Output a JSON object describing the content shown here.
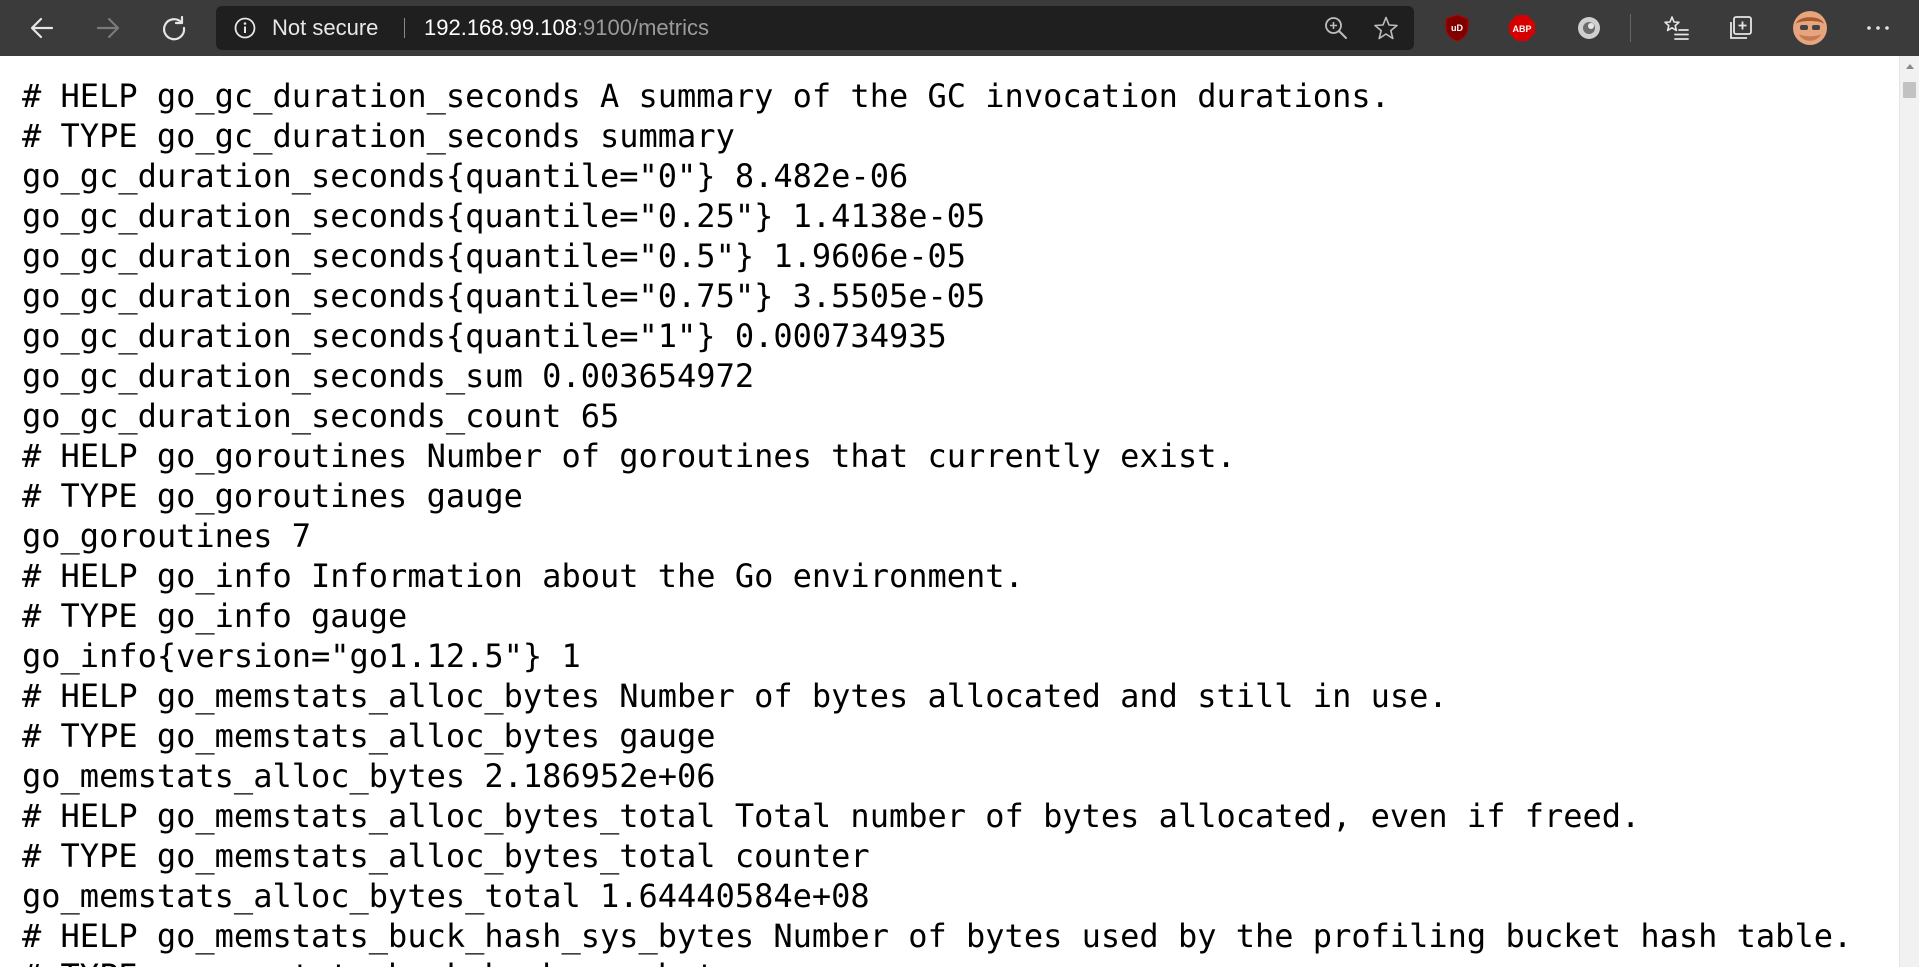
{
  "browser": {
    "security_label": "Not secure",
    "url_host": "192.168.99.108",
    "url_rest": ":9100/metrics",
    "extensions": [
      "ublock-origin-icon",
      "adblock-plus-icon",
      "circle-extension-icon"
    ],
    "abp_badge": "ABP",
    "ublock_badge": "uD",
    "accent_color": "#3b3b3b"
  },
  "metrics_lines": [
    "# HELP go_gc_duration_seconds A summary of the GC invocation durations.",
    "# TYPE go_gc_duration_seconds summary",
    "go_gc_duration_seconds{quantile=\"0\"} 8.482e-06",
    "go_gc_duration_seconds{quantile=\"0.25\"} 1.4138e-05",
    "go_gc_duration_seconds{quantile=\"0.5\"} 1.9606e-05",
    "go_gc_duration_seconds{quantile=\"0.75\"} 3.5505e-05",
    "go_gc_duration_seconds{quantile=\"1\"} 0.000734935",
    "go_gc_duration_seconds_sum 0.003654972",
    "go_gc_duration_seconds_count 65",
    "# HELP go_goroutines Number of goroutines that currently exist.",
    "# TYPE go_goroutines gauge",
    "go_goroutines 7",
    "# HELP go_info Information about the Go environment.",
    "# TYPE go_info gauge",
    "go_info{version=\"go1.12.5\"} 1",
    "# HELP go_memstats_alloc_bytes Number of bytes allocated and still in use.",
    "# TYPE go_memstats_alloc_bytes gauge",
    "go_memstats_alloc_bytes 2.186952e+06",
    "# HELP go_memstats_alloc_bytes_total Total number of bytes allocated, even if freed.",
    "# TYPE go_memstats_alloc_bytes_total counter",
    "go_memstats_alloc_bytes_total 1.64440584e+08",
    "# HELP go_memstats_buck_hash_sys_bytes Number of bytes used by the profiling bucket hash table.",
    "# TYPE go_memstats_buck_hash_sys_bytes gauge"
  ]
}
